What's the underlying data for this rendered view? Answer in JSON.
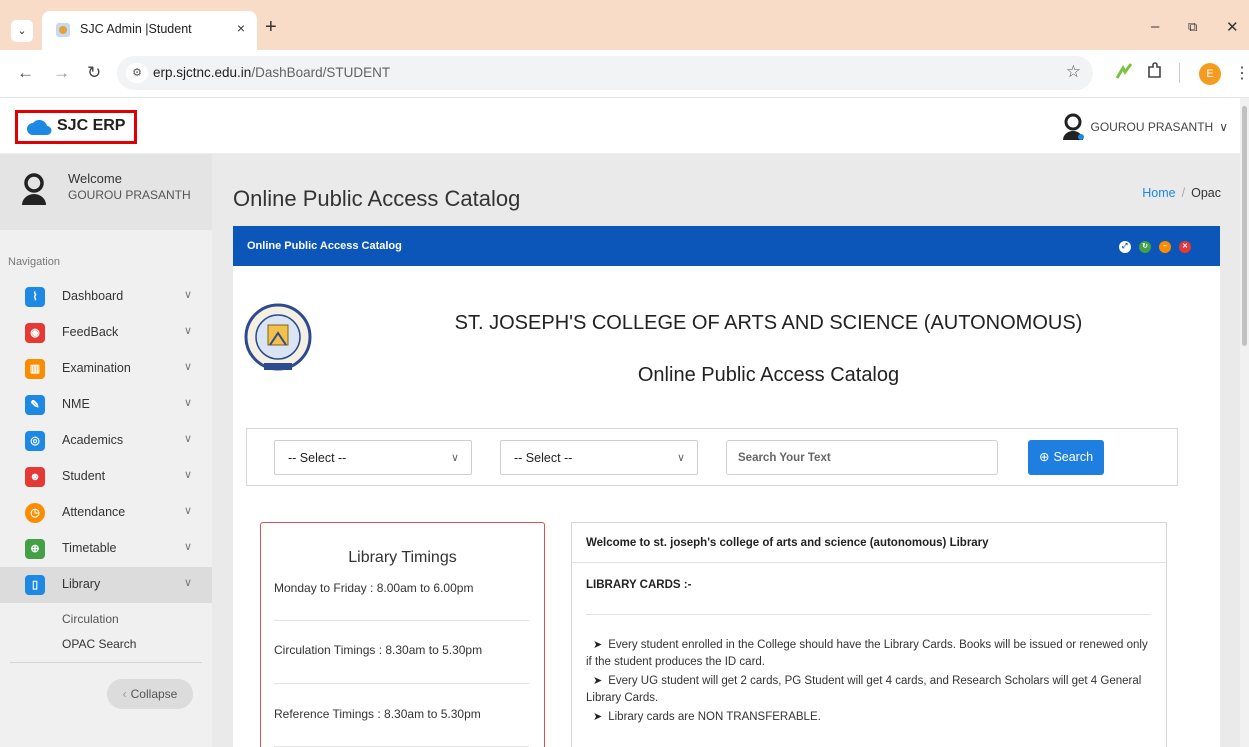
{
  "browser": {
    "tab_title": "SJC Admin |Student",
    "tab_close": "×",
    "new_tab": "+",
    "url_host": "erp.sjctnc.edu.in",
    "url_path": "/DashBoard/STUDENT",
    "profile_initial": "E",
    "window_min": "–",
    "window_restore": "⧉",
    "window_close": "✕"
  },
  "header": {
    "brand": "SJC ERP",
    "user_name": "GOUROU PRASANTH",
    "user_chevron": "∨"
  },
  "sidebar": {
    "welcome_label": "Welcome",
    "welcome_user": "GOUROU PRASANTH",
    "nav_heading": "Navigation",
    "items": [
      {
        "label": "Dashboard",
        "icon": "pulse-icon",
        "color": "#1e88e5"
      },
      {
        "label": "FeedBack",
        "icon": "rss-icon",
        "color": "#e53935"
      },
      {
        "label": "Examination",
        "icon": "book-icon",
        "color": "#fb8c00"
      },
      {
        "label": "NME",
        "icon": "edit-icon",
        "color": "#1e88e5"
      },
      {
        "label": "Academics",
        "icon": "target-icon",
        "color": "#1e88e5"
      },
      {
        "label": "Student",
        "icon": "users-icon",
        "color": "#e53935"
      },
      {
        "label": "Attendance",
        "icon": "clock-icon",
        "color": "#fb8c00"
      },
      {
        "label": "Timetable",
        "icon": "globe-icon",
        "color": "#43a047"
      },
      {
        "label": "Library",
        "icon": "book-open-icon",
        "color": "#1e88e5"
      }
    ],
    "library_sub": [
      "Circulation",
      "OPAC Search"
    ],
    "collapse_label": "Collapse"
  },
  "main": {
    "page_title": "Online Public Access Catalog",
    "breadcrumb_home": "Home",
    "breadcrumb_sep": "/",
    "breadcrumb_current": "Opac",
    "panel_title": "Online Public Access Catalog",
    "college_name": "ST. JOSEPH'S COLLEGE OF ARTS AND SCIENCE (AUTONOMOUS)",
    "subtitle": "Online Public Access Catalog",
    "select1": "-- Select --",
    "select2": "-- Select --",
    "search_placeholder": "Search Your Text",
    "search_button": "Search",
    "timings": {
      "title": "Library Timings",
      "rows": [
        "Monday to Friday : 8.00am to 6.00pm",
        "Circulation Timings : 8.30am to 5.30pm",
        "Reference Timings : 8.30am to 5.30pm"
      ]
    },
    "welcome_box": {
      "title": "Welcome to st. joseph's college of arts and science (autonomous) Library",
      "cards_heading": "LIBRARY CARDS :-",
      "paragraphs": [
        "Every student enrolled in the College should have the Library Cards. Books will be issued or renewed only if the student produces the ID card.",
        "Every UG student will get 2 cards, PG Student will get 4 cards, and Research Scholars will get 4 General Library Cards.",
        "Library cards are NON TRANSFERABLE."
      ]
    }
  },
  "colors": {
    "panel_header": "#0b56b8",
    "primary_button": "#1e7fe0",
    "brand_highlight_border": "#e00000",
    "timings_border": "#d9534f"
  }
}
